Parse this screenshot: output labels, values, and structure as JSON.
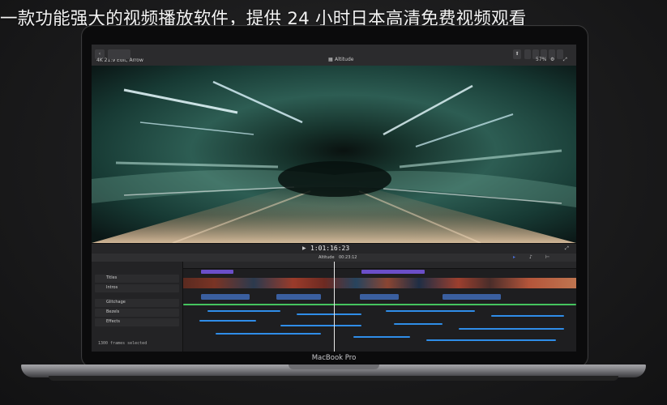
{
  "headline": "一款功能强大的视频播放软件，提供 24 小时日本高清免费视频观看",
  "laptop_brand": "MacBook Pro",
  "app": {
    "project_label": "4K 21:9 Edit, Arrow",
    "viewer_label": "Altitude",
    "zoom": "57%",
    "timecode": "1:01:16:23",
    "timeline_name": "Altitude",
    "timeline_duration": "00:23:12",
    "status_text": "1300 frames selected"
  },
  "browser": {
    "items": [
      {
        "label": "Titles"
      },
      {
        "label": "Intros"
      },
      {
        "label": "Glitchage"
      },
      {
        "label": "Bezels"
      },
      {
        "label": "Effects"
      }
    ]
  },
  "colors": {
    "accent": "#4a6fd6",
    "title_clip": "#6b4fc8",
    "audio_green": "#45c45f",
    "audio_blue": "#2f8de8"
  }
}
